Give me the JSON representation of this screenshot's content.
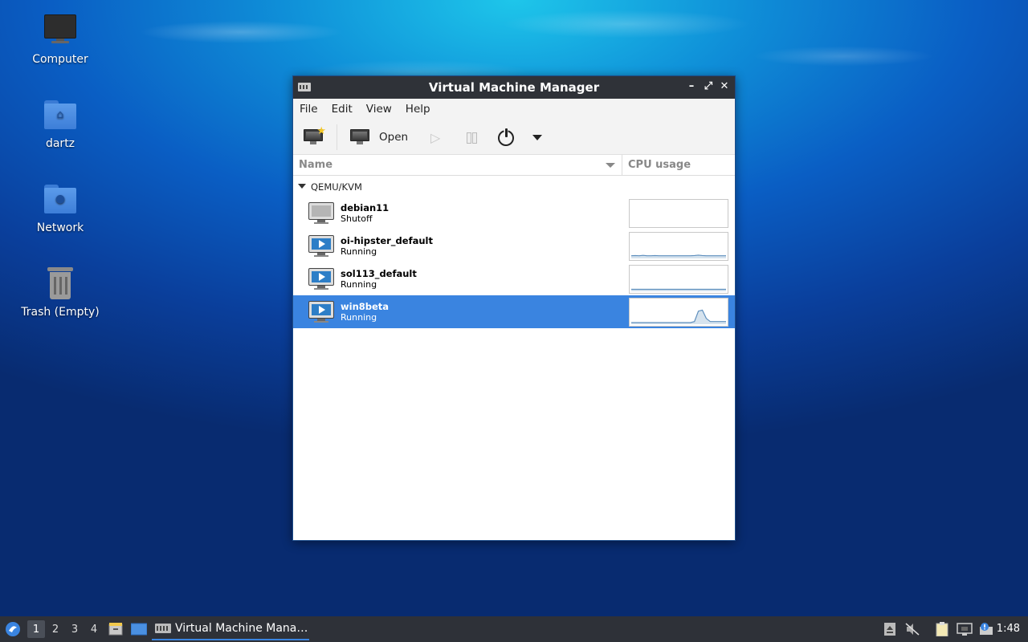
{
  "desktop": {
    "icons": [
      {
        "label": "Computer"
      },
      {
        "label": "dartz"
      },
      {
        "label": "Network"
      },
      {
        "label": "Trash (Empty)"
      }
    ]
  },
  "window": {
    "title": "Virtual Machine Manager",
    "controls": {
      "minimize": "–",
      "maximize": "⤢",
      "close": "✕"
    }
  },
  "menu": {
    "file": "File",
    "edit": "Edit",
    "view": "View",
    "help": "Help"
  },
  "toolbar": {
    "open_label": "Open"
  },
  "columns": {
    "name": "Name",
    "cpu": "CPU usage"
  },
  "group": {
    "label": "QEMU/KVM"
  },
  "vms": [
    {
      "name": "debian11",
      "status": "Shutoff",
      "cpu_usage": [
        0,
        0,
        0,
        0,
        0,
        0,
        0,
        0,
        0,
        0,
        0,
        0,
        0,
        0,
        0,
        0,
        0,
        0,
        0,
        0,
        0,
        0,
        0,
        0,
        0
      ]
    },
    {
      "name": "oi-hipster_default",
      "status": "Running",
      "cpu_usage": [
        0.05,
        0.06,
        0.05,
        0.07,
        0.05,
        0.05,
        0.06,
        0.05,
        0.05,
        0.05,
        0.05,
        0.05,
        0.05,
        0.05,
        0.05,
        0.05,
        0.06,
        0.08,
        0.06,
        0.05,
        0.05,
        0.05,
        0.05,
        0.05,
        0.05
      ]
    },
    {
      "name": "sol113_default",
      "status": "Running",
      "cpu_usage": [
        0.02,
        0.02,
        0.02,
        0.02,
        0.02,
        0.02,
        0.02,
        0.02,
        0.02,
        0.02,
        0.02,
        0.02,
        0.02,
        0.02,
        0.02,
        0.02,
        0.02,
        0.02,
        0.02,
        0.02,
        0.02,
        0.02,
        0.02,
        0.02,
        0.02
      ]
    },
    {
      "name": "win8beta",
      "status": "Running",
      "selected": true,
      "cpu_usage": [
        0,
        0,
        0,
        0,
        0,
        0,
        0,
        0,
        0,
        0,
        0,
        0,
        0,
        0,
        0,
        0,
        0.05,
        0.55,
        0.6,
        0.2,
        0.05,
        0.05,
        0.05,
        0.05,
        0.05
      ]
    }
  ],
  "taskbar": {
    "workspaces": [
      "1",
      "2",
      "3",
      "4"
    ],
    "task_label": "Virtual Machine Mana…",
    "clock": "1:48"
  },
  "colors": {
    "accent": "#3a84e0",
    "sparkline": "#5d8ebd"
  }
}
